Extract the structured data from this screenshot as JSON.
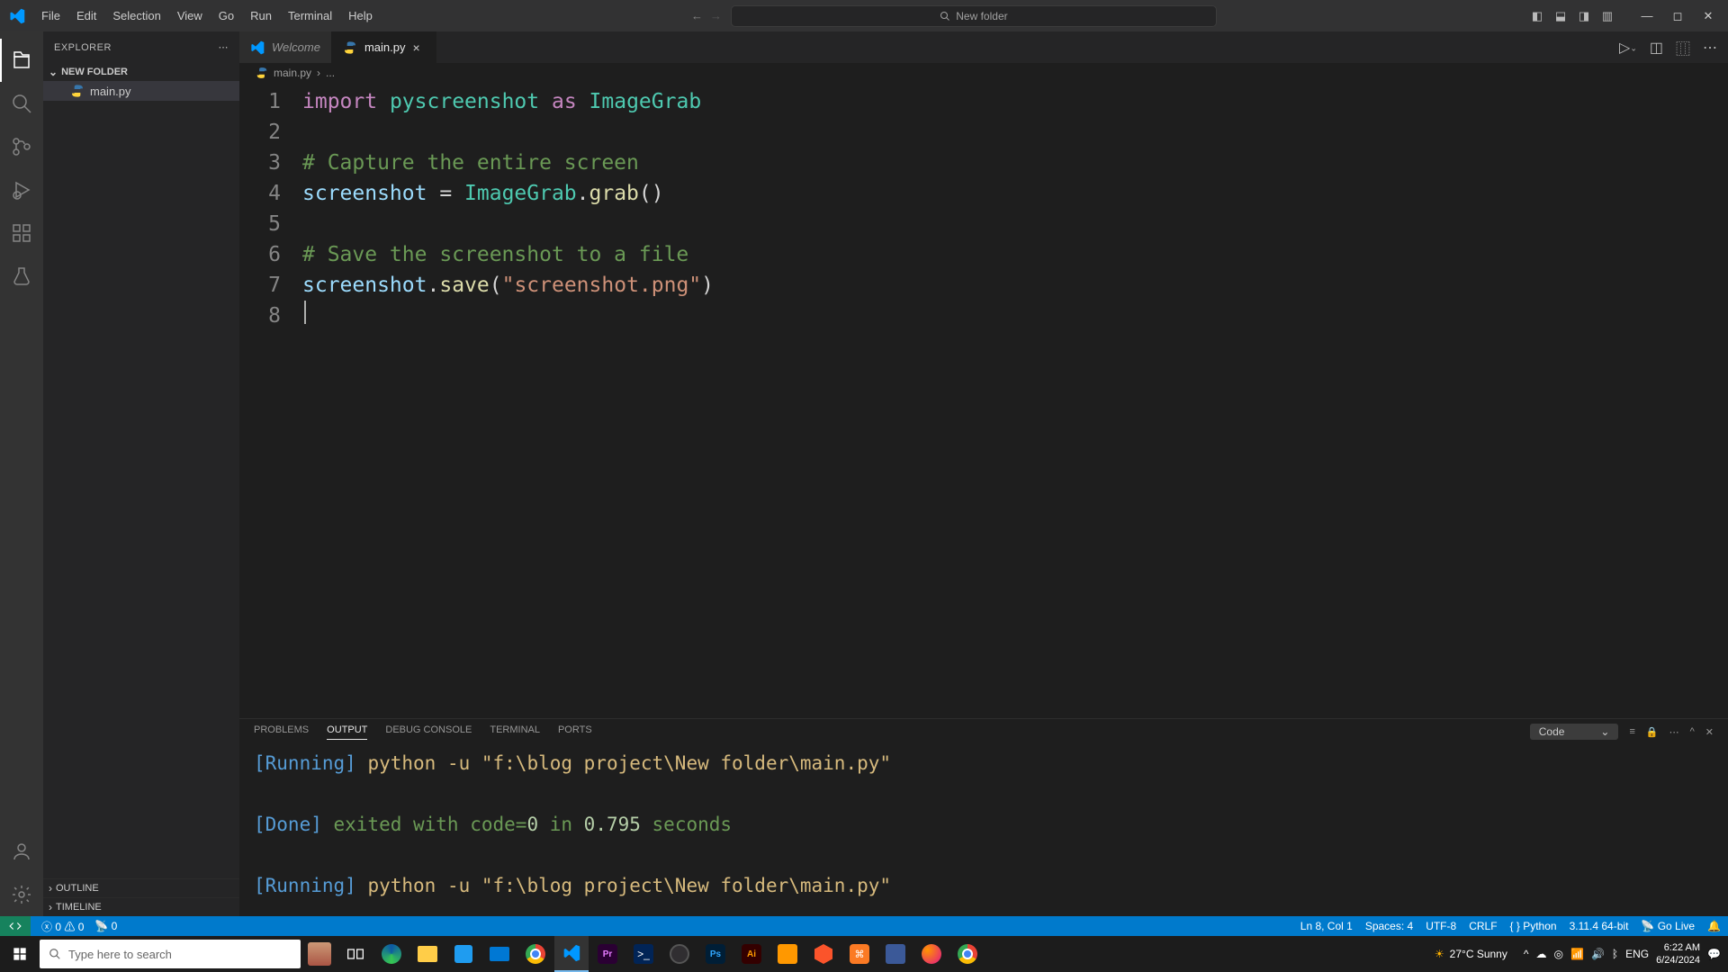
{
  "menu": {
    "file": "File",
    "edit": "Edit",
    "selection": "Selection",
    "view": "View",
    "go": "Go",
    "run": "Run",
    "terminal": "Terminal",
    "help": "Help"
  },
  "search_placeholder": "New folder",
  "explorer": {
    "title": "EXPLORER",
    "folder": "NEW FOLDER",
    "file": "main.py",
    "outline": "OUTLINE",
    "timeline": "TIMELINE"
  },
  "tabs": {
    "welcome": "Welcome",
    "main": "main.py"
  },
  "breadcrumb": {
    "file": "main.py",
    "rest": "..."
  },
  "code": {
    "l1_import": "import",
    "l1_mod": "pyscreenshot",
    "l1_as": "as",
    "l1_alias": "ImageGrab",
    "l3": "# Capture the entire screen",
    "l4_var": "screenshot",
    "l4_eq": " = ",
    "l4_cls": "ImageGrab",
    "l4_dot": ".",
    "l4_fn": "grab",
    "l4_par": "()",
    "l6": "# Save the screenshot to a file",
    "l7_var": "screenshot",
    "l7_dot": ".",
    "l7_fn": "save",
    "l7_open": "(",
    "l7_str": "\"screenshot.png\"",
    "l7_close": ")"
  },
  "panel": {
    "problems": "PROBLEMS",
    "output": "OUTPUT",
    "debug": "DEBUG CONSOLE",
    "terminal": "TERMINAL",
    "ports": "PORTS",
    "selector": "Code",
    "out1_tag": "[Running]",
    "out1_rest": " python -u \"f:\\blog project\\New folder\\main.py\"",
    "out2_tag": "[Done]",
    "out2_mid": " exited with code=",
    "out2_code": "0",
    "out2_in": " in ",
    "out2_time": "0.795",
    "out2_sec": " seconds",
    "out3_tag": "[Running]",
    "out3_rest": " python -u \"f:\\blog project\\New folder\\main.py\""
  },
  "status": {
    "errors": "0",
    "warnings": "0",
    "ports": "0",
    "ln": "Ln 8, Col 1",
    "spaces": "Spaces: 4",
    "encoding": "UTF-8",
    "eol": "CRLF",
    "lang": "Python",
    "py": "3.11.4 64-bit",
    "golive": "Go Live"
  },
  "taskbar": {
    "search": "Type here to search",
    "weather_temp": "27°C",
    "weather_cond": "Sunny",
    "lang": "ENG",
    "time": "6:22 AM",
    "date": "6/24/2024"
  }
}
